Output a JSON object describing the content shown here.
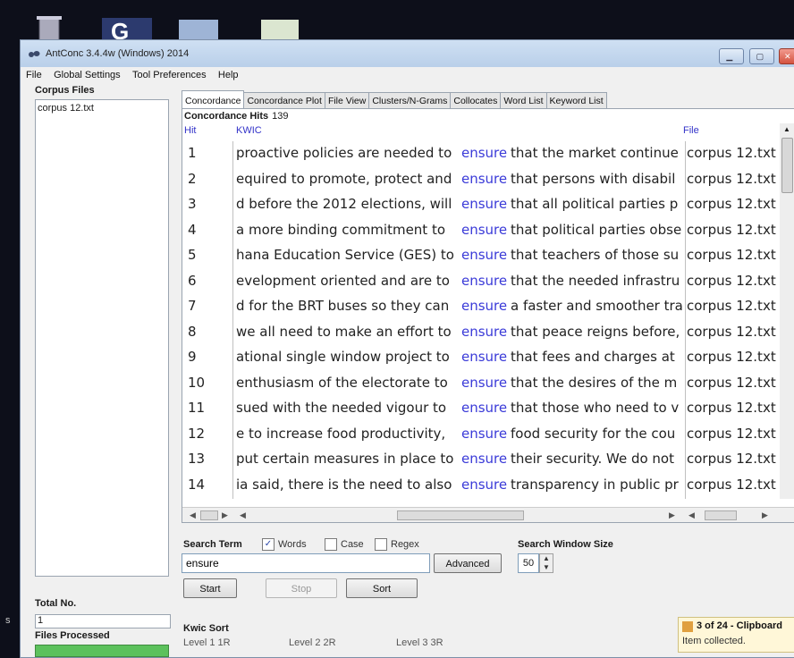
{
  "window": {
    "title": "AntConc 3.4.4w (Windows) 2014"
  },
  "menu": [
    "File",
    "Global Settings",
    "Tool Preferences",
    "Help"
  ],
  "left_panel": {
    "corpus_files_label": "Corpus Files",
    "files": [
      "corpus 12.txt"
    ],
    "total_no_label": "Total No.",
    "total_no_value": "1",
    "files_processed_label": "Files Processed",
    "files_processed_fraction": 1.0
  },
  "tabs": [
    "Concordance",
    "Concordance Plot",
    "File View",
    "Clusters/N-Grams",
    "Collocates",
    "Word List",
    "Keyword List"
  ],
  "concordance": {
    "hits_label": "Concordance Hits",
    "hits_count": "139",
    "col_hit": "Hit",
    "col_kwic": "KWIC",
    "col_file": "File",
    "rows": [
      {
        "hit": "1",
        "left": "proactive policies are needed to",
        "kw": "ensure",
        "right": "that the market continue",
        "file": "corpus 12.txt"
      },
      {
        "hit": "2",
        "left": "equired to promote, protect and",
        "kw": "ensure",
        "right": "that persons with disabil",
        "file": "corpus 12.txt"
      },
      {
        "hit": "3",
        "left": "d before the 2012 elections, will",
        "kw": "ensure",
        "right": "that all political parties p",
        "file": "corpus 12.txt"
      },
      {
        "hit": "4",
        "left": "a more binding commitment to",
        "kw": "ensure",
        "right": "that political parties obse",
        "file": "corpus 12.txt"
      },
      {
        "hit": "5",
        "left": "hana Education Service (GES) to",
        "kw": "ensure",
        "right": "that teachers of those su",
        "file": "corpus 12.txt"
      },
      {
        "hit": "6",
        "left": "evelopment oriented and are to",
        "kw": "ensure",
        "right": "that the needed infrastru",
        "file": "corpus 12.txt"
      },
      {
        "hit": "7",
        "left": "d for the BRT buses so they can",
        "kw": "ensure",
        "right": "a faster and smoother tra",
        "file": "corpus 12.txt"
      },
      {
        "hit": "8",
        "left": "we all need to make an effort to",
        "kw": "ensure",
        "right": "that peace reigns before,",
        "file": "corpus 12.txt"
      },
      {
        "hit": "9",
        "left": "ational single window project to",
        "kw": "ensure",
        "right": "that fees and charges at",
        "file": "corpus 12.txt"
      },
      {
        "hit": "10",
        "left": "enthusiasm of the electorate to",
        "kw": "ensure",
        "right": "that the desires of the m",
        "file": "corpus 12.txt"
      },
      {
        "hit": "11",
        "left": "sued with the needed vigour to",
        "kw": "ensure",
        "right": "that those who need to v",
        "file": "corpus 12.txt"
      },
      {
        "hit": "12",
        "left": "e to increase food productivity,",
        "kw": "ensure",
        "right": "food security for the cou",
        "file": "corpus 12.txt"
      },
      {
        "hit": "13",
        "left": "put certain measures in place to",
        "kw": "ensure",
        "right": "their security. We do not",
        "file": "corpus 12.txt"
      },
      {
        "hit": "14",
        "left": "ia said, there is the need to also",
        "kw": "ensure",
        "right": "transparency in public pr",
        "file": "corpus 12.txt"
      }
    ]
  },
  "search": {
    "label": "Search Term",
    "words_label": "Words",
    "case_label": "Case",
    "regex_label": "Regex",
    "words_checked": true,
    "term": "ensure",
    "advanced_label": "Advanced",
    "window_size_label": "Search Window Size",
    "window_size": "50",
    "start_label": "Start",
    "stop_label": "Stop",
    "sort_label": "Sort"
  },
  "kwic_sort": {
    "label": "Kwic Sort",
    "levels": [
      {
        "label": "Level 1",
        "value": "1R"
      },
      {
        "label": "Level 2",
        "value": "2R"
      },
      {
        "label": "Level 3",
        "value": "3R"
      }
    ]
  },
  "notification": {
    "title": "3 of 24 - Clipboard",
    "text": "Item collected."
  },
  "colors": {
    "kwic_keyword": "#3a3ad8",
    "progress": "#5cc15c",
    "header_link": "#3232c8"
  }
}
